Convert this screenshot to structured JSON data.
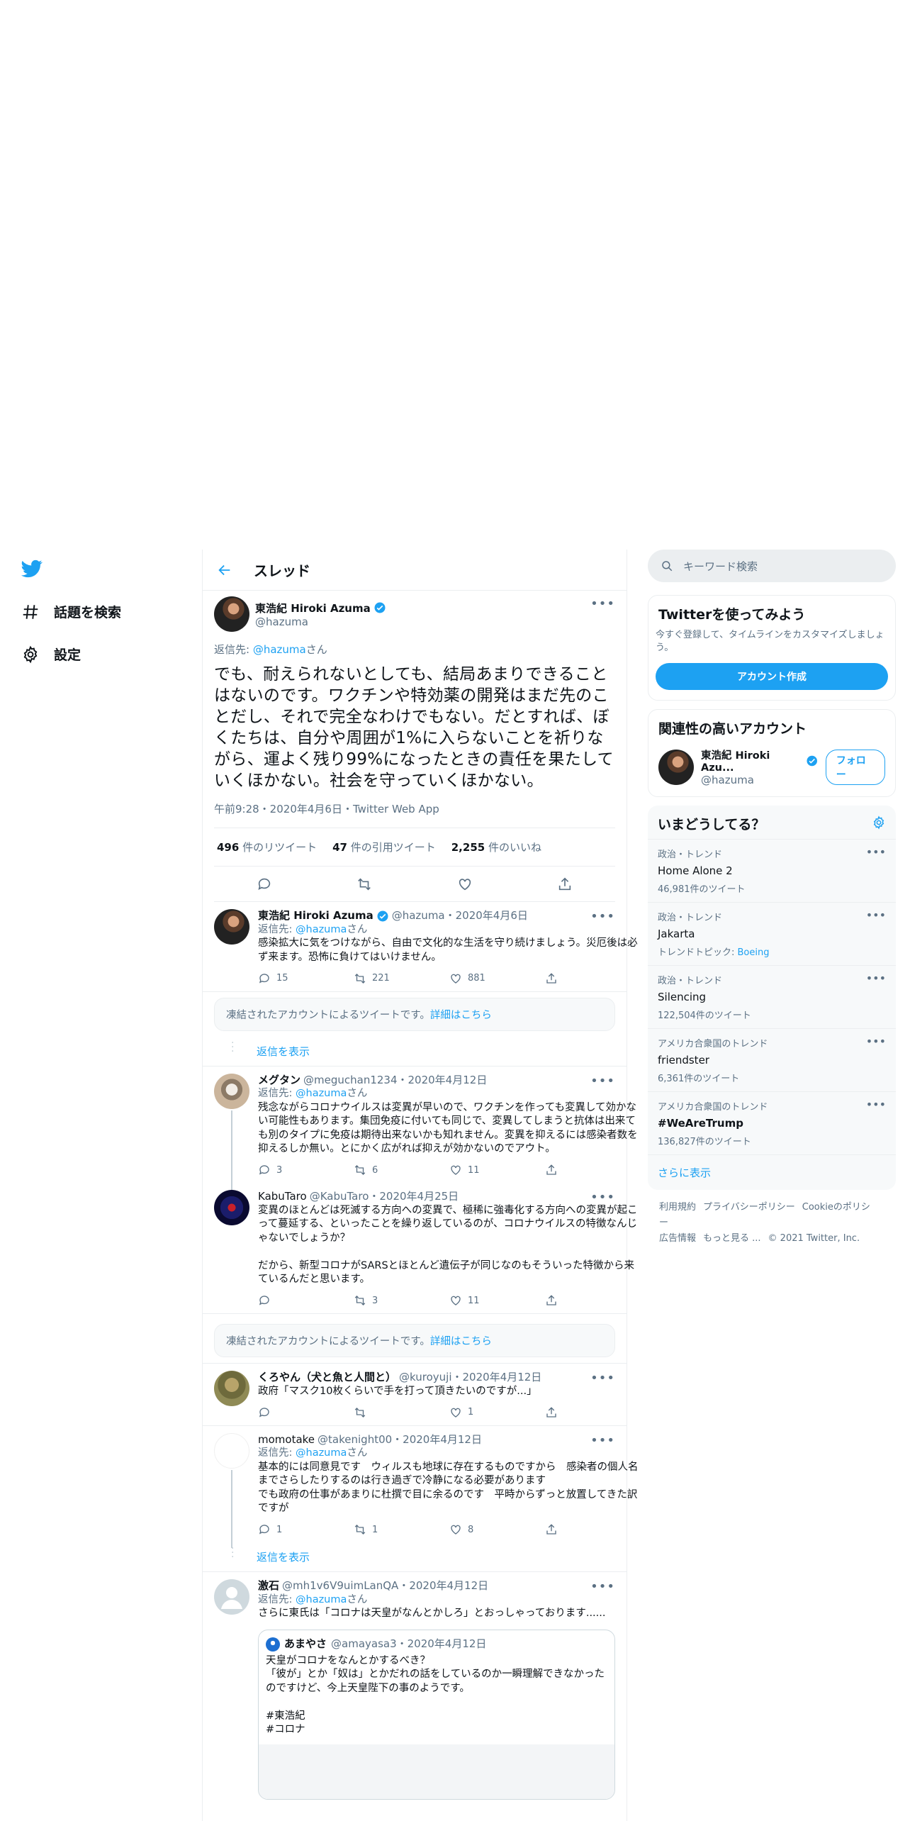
{
  "nav": {
    "explore": "話題を検索",
    "settings": "設定"
  },
  "header": {
    "title": "スレッド"
  },
  "main_tweet": {
    "name": "東浩紀 Hiroki Azuma",
    "handle": "@hazuma",
    "reply_prefix": "返信先: ",
    "reply_handle": "@hazuma",
    "reply_suffix": "さん",
    "text": "でも、耐えられないとしても、結局あまりできることはないのです。ワクチンや特効薬の開発はまだ先のことだし、それで完全なわけでもない。だとすれば、ぼくたちは、自分や周囲が1%に入らないことを祈りながら、運よく残り99%になったときの責任を果たしていくほかない。社会を守っていくほかない。",
    "meta": "午前9:28・2020年4月6日・Twitter Web App",
    "retweets": "496",
    "retweets_label": " 件のリツイート",
    "quotes": "47",
    "quotes_label": " 件の引用ツイート",
    "likes": "2,255",
    "likes_label": " 件のいいね"
  },
  "reply_azuma": {
    "name": "東浩紀 Hiroki Azuma",
    "handle_date": "@hazuma・2020年4月6日",
    "reply_to": "返信先: ",
    "reply_handle": "@hazuma",
    "reply_suffix": "さん",
    "text": "感染拡大に気をつけながら、自由で文化的な生活を守り続けましょう。災厄後は必ず来ます。恐怖に負けてはいけません。",
    "replies": "15",
    "retweets": "221",
    "likes": "881"
  },
  "suspended1": {
    "text": "凍結されたアカウントによるツイートです。",
    "link": "詳細はこちら"
  },
  "show_replies": "返信を表示",
  "megu": {
    "name": "メグタン",
    "handle_date": "@meguchan1234・2020年4月12日",
    "reply_to": "返信先: ",
    "reply_handle": "@hazuma",
    "reply_suffix": "さん",
    "text": "残念ながらコロナウイルスは変異が早いので、ワクチンを作っても変異して効かない可能性もあります。集団免疫に付いても同じで、変異してしまうと抗体は出来ても別のタイプに免疫は期待出来ないかも知れません。変異を抑えるには感染者数を抑えるしか無い。とにかく広がれば抑えが効かないのでアウト。",
    "replies": "3",
    "retweets": "6",
    "likes": "11"
  },
  "kabu": {
    "name": "KabuTaro",
    "handle_date": "@KabuTaro・2020年4月25日",
    "text": "変異のほとんどは死滅する方向への変異で、極稀に強毒化する方向への変異が起こって蔓延する、といったことを繰り返しているのが、コロナウイルスの特徴なんじゃないでしょうか？\n\nだから、新型コロナがSARSとほとんど遺伝子が同じなのもそういった特徴から来ているんだと思います。",
    "retweets": "3",
    "likes": "11"
  },
  "suspended2": {
    "text": "凍結されたアカウントによるツイートです。",
    "link": "詳細はこちら"
  },
  "kuro": {
    "name": "くろやん（犬と魚と人間と）",
    "handle_date": "@kuroyuji・2020年4月12日",
    "text": "政府「マスク10枚くらいで手を打って頂きたいのですが...」",
    "likes": "1"
  },
  "momo": {
    "name": "momotake",
    "handle_date": "@takenight00・2020年4月12日",
    "reply_to": "返信先: ",
    "reply_handle": "@hazuma",
    "reply_suffix": "さん",
    "text": "基本的には同意見です　ウィルスも地球に存在するものですから　感染者の個人名までさらしたりするのは行き過ぎで冷静になる必要があります\nでも政府の仕事があまりに杜撰で目に余るのです　平時からずっと放置してきた訳ですが",
    "replies": "1",
    "retweets": "1",
    "likes": "8"
  },
  "show_replies2": "返信を表示",
  "geki": {
    "name": "激石",
    "handle_date": "@mh1v6V9uimLanQA・2020年4月12日",
    "reply_to": "返信先: ",
    "reply_handle": "@hazuma",
    "reply_suffix": "さん",
    "text": "さらに東氏は「コロナは天皇がなんとかしろ」とおっしゃっております......",
    "quote": {
      "name": "あまやさ",
      "handle_date": "@amayasa3・2020年4月12日",
      "text": "天皇がコロナをなんとかするべき？\n「彼が」とか「奴は」とかだれの話をしているのか一瞬理解できなかったのですけど、今上天皇陛下の事のようです。\n\n#東浩紀\n#コロナ"
    }
  },
  "right": {
    "search_placeholder": "キーワード検索",
    "signup_title": "Twitterを使ってみよう",
    "signup_sub": "今すぐ登録して、タイムラインをカスタマイズしましょう。",
    "signup_btn": "アカウント作成",
    "related_title": "関連性の高いアカウント",
    "related_name": "東浩紀 Hiroki Azu...",
    "related_handle": "@hazuma",
    "follow_btn": "フォロー",
    "trends_title": "いまどうしてる？",
    "trends": [
      {
        "cat": "政治・トレンド",
        "name": "Home Alone 2",
        "count": "46,981件のツイート"
      },
      {
        "cat": "政治・トレンド",
        "name": "Jakarta",
        "topic_label": "トレンドトピック: ",
        "topic": "Boeing"
      },
      {
        "cat": "政治・トレンド",
        "name": "Silencing",
        "count": "122,504件のツイート"
      },
      {
        "cat": "アメリカ合衆国のトレンド",
        "name": "friendster",
        "count": "6,361件のツイート"
      },
      {
        "cat": "アメリカ合衆国のトレンド",
        "name": "#WeAreTrump",
        "count": "136,827件のツイート"
      }
    ],
    "show_more": "さらに表示",
    "footer": [
      "利用規約",
      "プライバシーポリシー",
      "Cookieのポリシー",
      "広告情報",
      "もっと見る ...",
      "© 2021 Twitter, Inc."
    ]
  },
  "colors": {
    "accent": "#1da1f2",
    "muted": "#5b7083",
    "border": "#ebeef0"
  }
}
